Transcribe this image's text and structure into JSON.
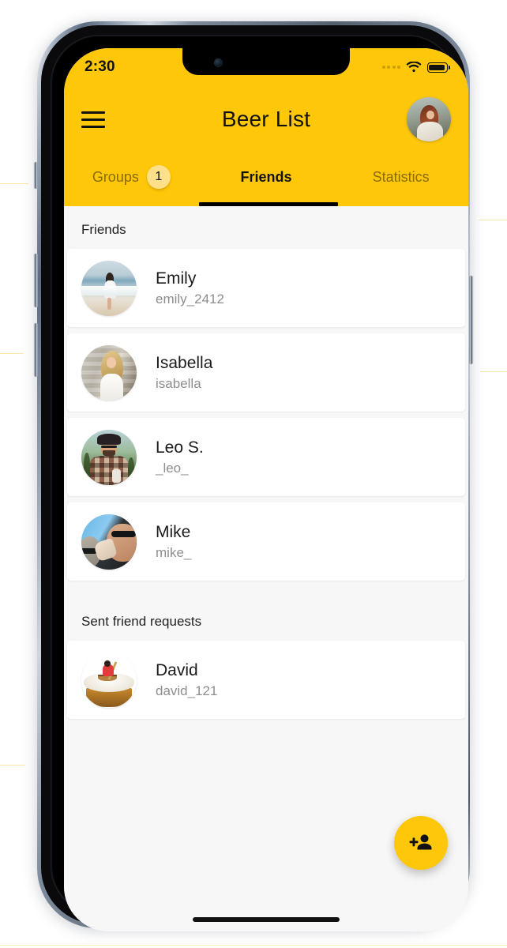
{
  "status_bar": {
    "time": "2:30",
    "signal_dots": 4,
    "wifi_icon": "wifi-icon",
    "battery_icon": "battery-full-icon"
  },
  "header": {
    "title": "Beer List",
    "menu_icon": "hamburger-menu-icon",
    "profile_avatar": "user-profile-avatar",
    "background_color": "#FFC709"
  },
  "tabs": [
    {
      "label": "Groups",
      "badge": "1",
      "active": false
    },
    {
      "label": "Friends",
      "badge": "",
      "active": true
    },
    {
      "label": "Statistics",
      "badge": "",
      "active": false
    }
  ],
  "sections": [
    {
      "header": "Friends",
      "rows": [
        {
          "name": "Emily",
          "handle": "emily_2412",
          "avatar": "avatar-emily-beach"
        },
        {
          "name": "Isabella",
          "handle": "isabella",
          "avatar": "avatar-isabella-stonewall"
        },
        {
          "name": "Leo S.",
          "handle": "_leo_",
          "avatar": "avatar-leo-plaid"
        },
        {
          "name": "Mike",
          "handle": "mike_",
          "avatar": "avatar-mike-drinking"
        }
      ]
    },
    {
      "header": "Sent friend requests",
      "rows": [
        {
          "name": "David",
          "handle": "david_121",
          "avatar": "avatar-david-beerboat"
        }
      ]
    }
  ],
  "fab": {
    "icon": "person-add-icon",
    "color": "#FFC709"
  },
  "home_indicator": "home-indicator-bar",
  "colors": {
    "accent": "#FFC709",
    "badge": "#FFE08A",
    "tab_inactive_text": "#8A6C07",
    "tab_active_text": "#111111",
    "list_background": "#F7F7F7",
    "card_background": "#FFFFFF",
    "name_text": "#1B1B1B",
    "handle_text": "#8D8D8D"
  }
}
